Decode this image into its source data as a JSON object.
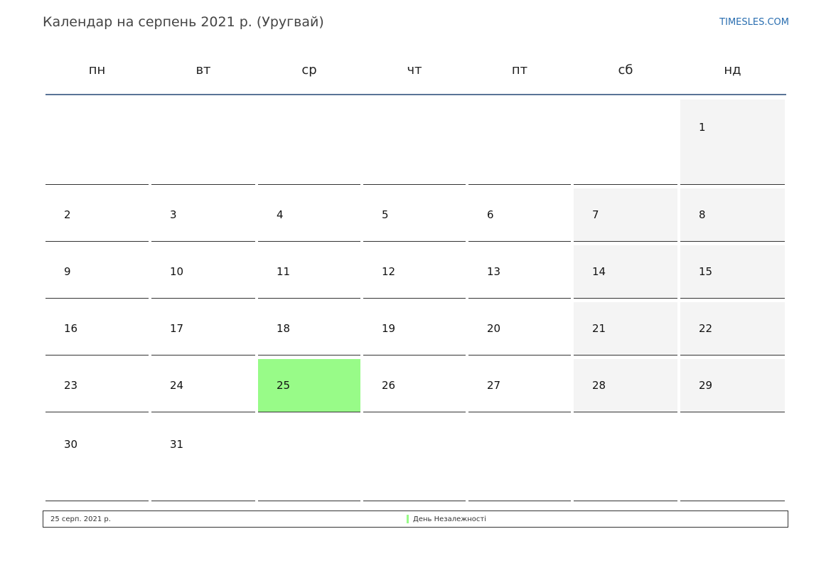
{
  "header": {
    "title": "Календар на серпень 2021 р. (Уругвай)",
    "brand": "TIMESLES.COM"
  },
  "weekdays": [
    "пн",
    "вт",
    "ср",
    "чт",
    "пт",
    "сб",
    "нд"
  ],
  "weeks": [
    [
      null,
      null,
      null,
      null,
      null,
      null,
      "1"
    ],
    [
      "2",
      "3",
      "4",
      "5",
      "6",
      "7",
      "8"
    ],
    [
      "9",
      "10",
      "11",
      "12",
      "13",
      "14",
      "15"
    ],
    [
      "16",
      "17",
      "18",
      "19",
      "20",
      "21",
      "22"
    ],
    [
      "23",
      "24",
      "25",
      "26",
      "27",
      "28",
      "29"
    ],
    [
      "30",
      "31",
      null,
      null,
      null,
      null,
      null
    ]
  ],
  "holiday_day": "25",
  "colors": {
    "holiday": "#98fb88",
    "weekend": "#f4f4f4",
    "header_rule": "#5a7497",
    "brand": "#2a6eb0"
  },
  "legend": {
    "date": "25 серп. 2021 р.",
    "name": "День Незалежності"
  }
}
